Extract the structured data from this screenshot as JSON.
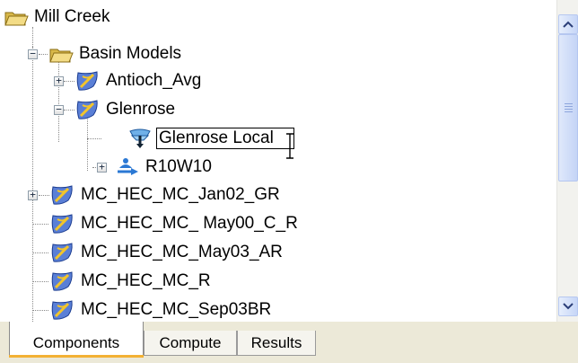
{
  "tree": {
    "nodes": [
      {
        "label": "Mill Creek",
        "icon": "folder-open-icon"
      },
      {
        "label": "Basin Models",
        "icon": "folder-open-icon",
        "expander": "minus"
      },
      {
        "label": "Antioch_Avg",
        "icon": "basin-model-icon",
        "expander": "plus"
      },
      {
        "label": "Glenrose",
        "icon": "basin-model-icon",
        "expander": "minus"
      },
      {
        "label": "Glenrose Local",
        "icon": "subbasin-icon",
        "editing": true
      },
      {
        "label": "R10W10",
        "icon": "reach-icon",
        "expander": "plus"
      },
      {
        "label": "MC_HEC_MC_Jan02_GR",
        "icon": "basin-model-icon",
        "expander": "plus"
      },
      {
        "label": "MC_HEC_MC_ May00_C_R",
        "icon": "basin-model-icon"
      },
      {
        "label": "MC_HEC_MC_May03_AR",
        "icon": "basin-model-icon"
      },
      {
        "label": "MC_HEC_MC_R",
        "icon": "basin-model-icon"
      },
      {
        "label": "MC_HEC_MC_Sep03BR",
        "icon": "basin-model-icon"
      }
    ]
  },
  "tabs": [
    {
      "label": "Components",
      "active": true
    },
    {
      "label": "Compute",
      "active": false
    },
    {
      "label": "Results",
      "active": false
    }
  ],
  "colors": {
    "tab_accent": "#f3b134",
    "scrollbar": "#c6d6f7",
    "folder": "#e8c85a"
  }
}
